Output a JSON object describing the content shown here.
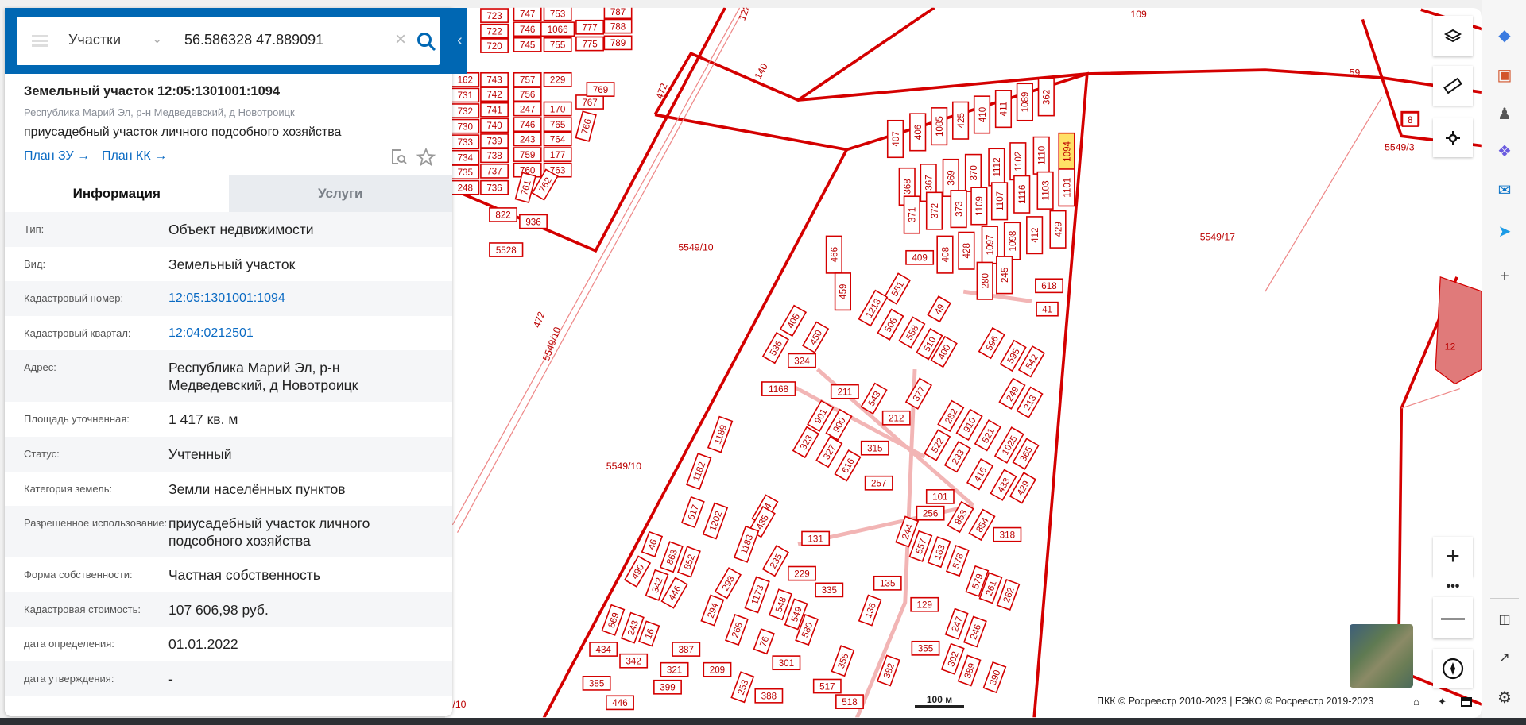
{
  "search": {
    "filter_type": "Участки",
    "query": "56.586328 47.889091"
  },
  "object": {
    "title": "Земельный участок 12:05:1301001:1094",
    "address": "Республика Марий Эл, р-н Медведевский, д Новотроицк",
    "description": "приусадебный участок личного подсобного хозяйства",
    "links": [
      "План ЗУ →",
      "План КК →"
    ]
  },
  "tabs": [
    {
      "label": "Информация",
      "active": true
    },
    {
      "label": "Услуги",
      "active": false
    }
  ],
  "info": [
    {
      "label": "Тип:",
      "value": "Объект недвижимости"
    },
    {
      "label": "Вид:",
      "value": "Земельный участок"
    },
    {
      "label": "Кадастровый номер:",
      "value": "12:05:1301001:1094",
      "link": true
    },
    {
      "label": "Кадастровый квартал:",
      "value": "12:04:0212501",
      "link": true
    },
    {
      "label": "Адрес:",
      "value": "Республика Марий Эл, р-н Медведевский, д Новотроицк"
    },
    {
      "label": "Площадь уточненная:",
      "value": "1 417 кв. м"
    },
    {
      "label": "Статус:",
      "value": "Учтенный"
    },
    {
      "label": "Категория земель:",
      "value": "Земли населённых пунктов"
    },
    {
      "label": "Разрешенное использование:",
      "value": "приусадебный участок личного подсобного хозяйства"
    },
    {
      "label": "Форма собственности:",
      "value": "Частная собственность"
    },
    {
      "label": "Кадастровая стоимость:",
      "value": "107 606,98 руб."
    },
    {
      "label": "дата определения:",
      "value": "01.01.2022"
    },
    {
      "label": "дата утверждения:",
      "value": "-"
    }
  ],
  "map": {
    "areas": [
      "5549/10",
      "5549/10",
      "5549/10",
      "472",
      "5549/17",
      "109",
      "59",
      "5549/3",
      "12",
      "140",
      "472",
      "122",
      "/10"
    ],
    "parcels": [
      "162",
      "731",
      "732",
      "730",
      "733",
      "734",
      "735",
      "248",
      "723",
      "722",
      "720",
      "743",
      "742",
      "741",
      "740",
      "739",
      "738",
      "737",
      "736",
      "747",
      "746",
      "745",
      "757",
      "756",
      "247",
      "746",
      "243",
      "759",
      "760",
      "753",
      "1066",
      "755",
      "229",
      "170",
      "765",
      "764",
      "177",
      "763",
      "777",
      "775",
      "767",
      "787",
      "788",
      "789",
      "769",
      "766",
      "822",
      "936",
      "5528",
      "761",
      "762",
      "407",
      "406",
      "1085",
      "425",
      "410",
      "411",
      "1089",
      "362",
      "1110",
      "1094",
      "1102",
      "1112",
      "370",
      "369",
      "367",
      "368",
      "1101",
      "1103",
      "1116",
      "1107",
      "1109",
      "373",
      "372",
      "371",
      "429",
      "412",
      "1098",
      "1097",
      "428",
      "408",
      "409",
      "466",
      "459",
      "551",
      "1213",
      "508",
      "558",
      "510",
      "400",
      "49",
      "280",
      "245",
      "618",
      "41",
      "596",
      "595",
      "542",
      "249",
      "213",
      "405",
      "450",
      "536",
      "324",
      "1168",
      "211",
      "543",
      "377",
      "212",
      "282",
      "910",
      "521",
      "1025",
      "365",
      "901",
      "900",
      "323",
      "327",
      "315",
      "616",
      "257",
      "522",
      "233",
      "416",
      "433",
      "429",
      "1189",
      "1182",
      "101",
      "256",
      "853",
      "854",
      "318",
      "617",
      "1202",
      "434",
      "435",
      "1183",
      "131",
      "46",
      "863",
      "852",
      "490",
      "342",
      "446",
      "244",
      "557",
      "183",
      "578",
      "579",
      "261",
      "262",
      "235",
      "229",
      "335",
      "293",
      "135",
      "1173",
      "294",
      "548",
      "549",
      "268",
      "580",
      "129",
      "247",
      "246",
      "136",
      "869",
      "243",
      "16",
      "434",
      "342",
      "387",
      "209",
      "76",
      "301",
      "355",
      "302",
      "389",
      "356",
      "382",
      "390",
      "321",
      "399",
      "253",
      "388",
      "517",
      "518",
      "385",
      "446",
      "8"
    ],
    "selected_parcel": "1094",
    "scale_label": "100 м",
    "attribution": "ПКК © Росреестр 2010-2023 | ЕЭКО © Росреестр 2019-2023",
    "colors": {
      "boundary": "#d40000",
      "selected": "#ffe066",
      "header": "#0067b3",
      "link": "#0a6ac3"
    }
  },
  "controls": [
    "layers-icon",
    "ruler-icon",
    "locate-icon",
    "zoom-in-icon",
    "more-icon",
    "zoom-out-icon",
    "compass-icon"
  ]
}
